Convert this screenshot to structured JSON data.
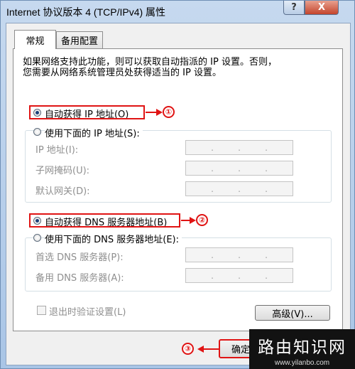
{
  "window": {
    "title": "Internet 协议版本 4 (TCP/IPv4) 属性",
    "help_label": "?",
    "close_label": "X"
  },
  "tabs": [
    {
      "label": "常规",
      "active": true
    },
    {
      "label": "备用配置",
      "active": false
    }
  ],
  "description": {
    "line1": "如果网络支持此功能，则可以获取自动指派的 IP 设置。否则，",
    "line2": "您需要从网络系统管理员处获得适当的 IP 设置。"
  },
  "ip_section": {
    "auto_label": "自动获得 IP 地址(O)",
    "auto_selected": true,
    "manual_label": "使用下面的 IP 地址(S):",
    "fields": [
      {
        "label": "IP 地址(I):",
        "value": ". . ."
      },
      {
        "label": "子网掩码(U):",
        "value": ". . ."
      },
      {
        "label": "默认网关(D):",
        "value": ". . ."
      }
    ]
  },
  "dns_section": {
    "auto_label": "自动获得 DNS 服务器地址(B)",
    "auto_selected": true,
    "manual_label": "使用下面的 DNS 服务器地址(E):",
    "fields": [
      {
        "label": "首选 DNS 服务器(P):",
        "value": ". . ."
      },
      {
        "label": "备用 DNS 服务器(A):",
        "value": ". . ."
      }
    ]
  },
  "validate_checkbox": {
    "label": "退出时验证设置(L)",
    "checked": false
  },
  "advanced_button": "高级(V)...",
  "ok_button": "确定",
  "annotations": {
    "step1": "①",
    "step2": "②",
    "step3": "③"
  },
  "watermark": {
    "title": "路由知识网",
    "url": "www.yilanbo.com"
  },
  "colors": {
    "annotation_red": "#e01414",
    "title_bar": "#b9d1ea",
    "close_red": "#c4442c"
  }
}
